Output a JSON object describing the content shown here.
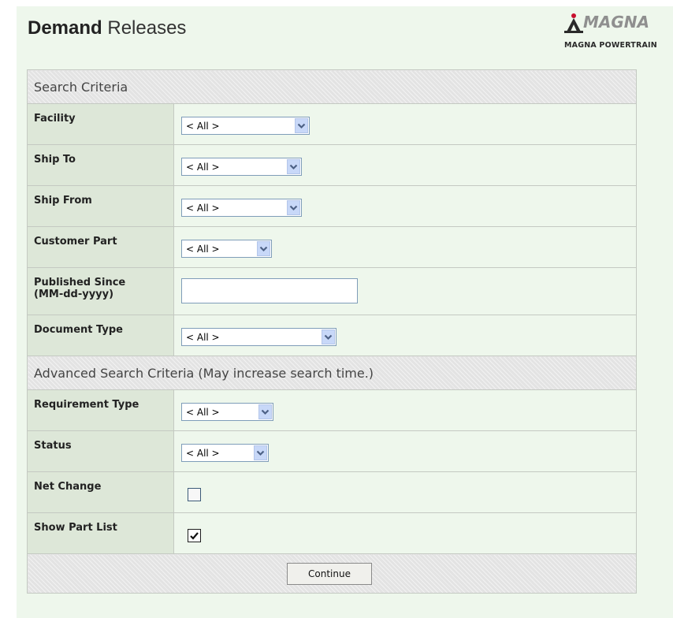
{
  "header": {
    "title_bold": "Demand",
    "title_rest": "Releases",
    "logo_word": "MAGNA",
    "logo_sub": "MAGNA POWERTRAIN"
  },
  "sections": {
    "search_criteria": "Search Criteria",
    "advanced": "Advanced Search Criteria (May increase search time.)"
  },
  "fields": {
    "facility": {
      "label": "Facility",
      "value": "< All >"
    },
    "ship_to": {
      "label": "Ship To",
      "value": "< All >"
    },
    "ship_from": {
      "label": "Ship From",
      "value": "< All >"
    },
    "customer_part": {
      "label": "Customer Part",
      "value": "< All >"
    },
    "published_since": {
      "label_line1": "Published Since",
      "label_line2": "(MM-dd-yyyy)",
      "value": ""
    },
    "document_type": {
      "label": "Document Type",
      "value": "< All >"
    },
    "requirement_type": {
      "label": "Requirement Type",
      "value": "< All >"
    },
    "status": {
      "label": "Status",
      "value": "< All >"
    },
    "net_change": {
      "label": "Net Change",
      "checked": false
    },
    "show_part_list": {
      "label": "Show Part List",
      "checked": true
    }
  },
  "actions": {
    "continue_label": "Continue"
  },
  "icons": {
    "dropdown": "chevron-down-icon",
    "checkmark": "checkmark-icon",
    "logo": "magna-logo-icon"
  },
  "colors": {
    "panel_bg": "#eef7ec",
    "label_bg": "#dde7d8",
    "section_bg": "#e3e3e3",
    "select_border": "#7f9db9",
    "dropdown_arrow_bg": "#c8d8f8"
  }
}
